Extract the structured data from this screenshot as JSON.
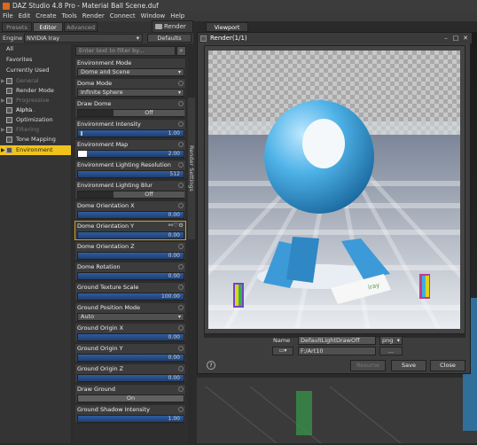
{
  "window": {
    "title": "DAZ Studio 4.8 Pro - Material Ball Scene.duf"
  },
  "menu": [
    "File",
    "Edit",
    "Create",
    "Tools",
    "Render",
    "Connect",
    "Window",
    "Help"
  ],
  "tabs": [
    {
      "label": "Presets"
    },
    {
      "label": "Editor"
    },
    {
      "label": "Advanced"
    }
  ],
  "render_button": "Render",
  "engine": {
    "label": "Engine :",
    "value": "NVIDIA Iray",
    "defaults": "Defaults"
  },
  "categories": [
    {
      "label": "All",
      "dim": false
    },
    {
      "label": "Favorites",
      "dim": false
    },
    {
      "label": "Currently Used",
      "dim": false
    },
    {
      "label": "General",
      "dim": true
    },
    {
      "label": "Render Mode",
      "dim": false
    },
    {
      "label": "Progressive Rend...",
      "dim": true
    },
    {
      "label": "Alpha",
      "dim": false
    },
    {
      "label": "Optimization",
      "dim": false
    },
    {
      "label": "Filtering",
      "dim": true
    },
    {
      "label": "Tone Mapping",
      "dim": false
    },
    {
      "label": "Environment",
      "dim": false,
      "selected": true
    }
  ],
  "filter_placeholder": "Enter text to filter by...",
  "properties": {
    "environment_mode": {
      "label": "Environment Mode",
      "value": "Dome and Scene"
    },
    "dome_mode": {
      "label": "Dome Mode",
      "value": "Infinite Sphere"
    },
    "draw_dome": {
      "label": "Draw Dome",
      "value": "Off"
    },
    "environment_intensity": {
      "label": "Environment Intensity",
      "value": "1.00"
    },
    "environment_map": {
      "label": "Environment Map",
      "value": "2.00"
    },
    "environment_lighting_resolution": {
      "label": "Environment Lighting Resolution",
      "value": "512"
    },
    "environment_lighting_blur": {
      "label": "Environment Lighting Blur",
      "value": "Off"
    },
    "dome_orientation_x": {
      "label": "Dome Orientation X",
      "value": "0.00"
    },
    "dome_orientation_y": {
      "label": "Dome Orientation Y",
      "value": "0.00"
    },
    "dome_orientation_z": {
      "label": "Dome Orientation Z",
      "value": "0.00"
    },
    "dome_rotation": {
      "label": "Dome Rotation",
      "value": "0.00"
    },
    "ground_texture_scale": {
      "label": "Ground Texture Scale",
      "value": "100.00"
    },
    "ground_position_mode": {
      "label": "Ground Position Mode",
      "value": "Auto"
    },
    "ground_origin_x": {
      "label": "Ground Origin X",
      "value": "0.00"
    },
    "ground_origin_y": {
      "label": "Ground Origin Y",
      "value": "0.00"
    },
    "ground_origin_z": {
      "label": "Ground Origin Z",
      "value": "0.00"
    },
    "draw_ground": {
      "label": "Draw Ground",
      "value": "On"
    },
    "ground_shadow_intensity": {
      "label": "Ground Shadow Intensity",
      "value": "1.00"
    }
  },
  "side_tab": "Render Settings",
  "viewport_tab": "Viewport",
  "dialog": {
    "title": "Render(1/1)",
    "name_label": "Name",
    "name_value": "DefaultLightDrawOff",
    "format": "png",
    "path": "F:/Art10",
    "browse": "...",
    "buttons": {
      "resume": "Resume",
      "save": "Save",
      "close": "Close"
    },
    "logo_text": "iray"
  }
}
